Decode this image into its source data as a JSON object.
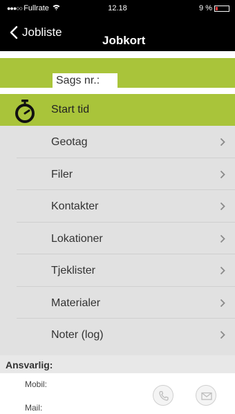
{
  "status_bar": {
    "signal": "●●●○○",
    "carrier": "Fullrate",
    "time": "12.18",
    "battery": "9 %",
    "battery_fill_percent": 9
  },
  "nav": {
    "back_label": "Jobliste",
    "title": "Jobkort"
  },
  "sags": {
    "label": "Sags nr.:"
  },
  "start": {
    "label": "Start tid"
  },
  "menu": {
    "items": [
      {
        "label": "Geotag"
      },
      {
        "label": "Filer"
      },
      {
        "label": "Kontakter"
      },
      {
        "label": "Lokationer"
      },
      {
        "label": "Tjeklister"
      },
      {
        "label": "Materialer"
      },
      {
        "label": "Noter (log)"
      }
    ]
  },
  "ansvarlig": {
    "header": "Ansvarlig:",
    "mobil_label": "Mobil:",
    "mail_label": "Mail:"
  },
  "colors": {
    "accent_green": "#a9c43a",
    "menu_bg": "#e1e1e1",
    "bar_bg": "#000000"
  },
  "icons": {
    "back": "chevron-left-icon",
    "timer": "stopwatch-icon",
    "chevron": "chevron-right-icon",
    "phone": "phone-icon",
    "mail": "envelope-icon"
  }
}
